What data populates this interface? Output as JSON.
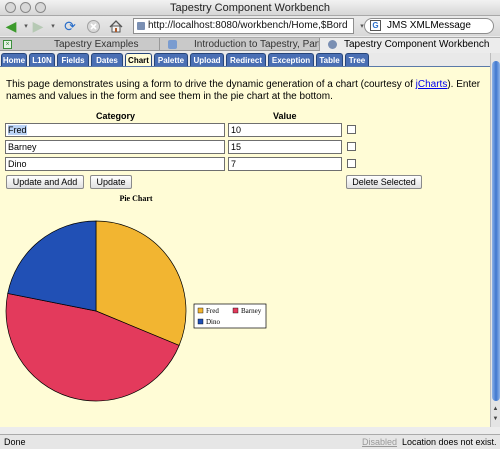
{
  "window": {
    "title": "Tapestry Component Workbench"
  },
  "toolbar": {
    "url": "http://localhost:8080/workbench/Home,$Bord",
    "search_value": "JMS XMLMessage"
  },
  "browser_tabs": [
    {
      "label": "Tapestry Examples",
      "active": false
    },
    {
      "label": "Introduction to Tapestry, Part I",
      "active": false
    },
    {
      "label": "Tapestry Component Workbench",
      "active": true
    }
  ],
  "page_tabs": [
    "Home",
    "L10N",
    "Fields",
    "Dates",
    "Chart",
    "Palette",
    "Upload",
    "Redirect",
    "Exception",
    "Table",
    "Tree"
  ],
  "active_page_tab": "Chart",
  "intro": {
    "text_before": "This page demonstrates using a form to drive the dynamic generation of a chart (courtesy of ",
    "link": "jCharts",
    "text_after": "). Enter names and values in the form and see them in the pie chart at the bottom."
  },
  "form": {
    "category_header": "Category",
    "value_header": "Value",
    "rows": [
      {
        "category": "Fred",
        "value": "10"
      },
      {
        "category": "Barney",
        "value": "15"
      },
      {
        "category": "Dino",
        "value": "7"
      }
    ],
    "update_and_add_label": "Update and Add",
    "update_label": "Update",
    "delete_selected_label": "Delete Selected"
  },
  "chart_data": {
    "type": "pie",
    "title": "Pie Chart",
    "categories": [
      "Fred",
      "Barney",
      "Dino"
    ],
    "values": [
      10,
      15,
      7
    ],
    "colors": [
      "#f2b531",
      "#e33a5c",
      "#2150b5"
    ],
    "legend_position": "right"
  },
  "status": {
    "left": "Done",
    "disabled": "Disabled",
    "right": "Location does not exist."
  }
}
